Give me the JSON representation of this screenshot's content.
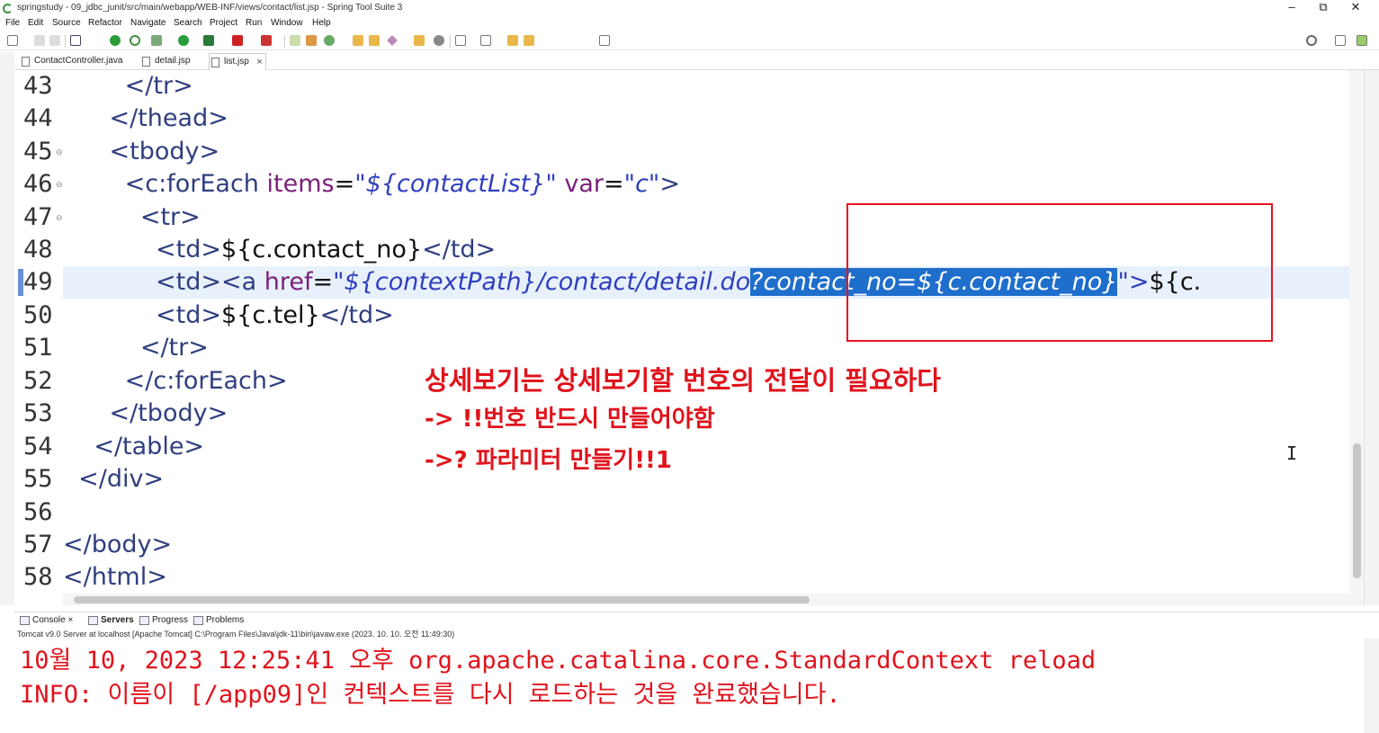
{
  "window": {
    "title": "springstudy - 09_jdbc_junit/src/main/webapp/WEB-INF/views/contact/list.jsp - Spring Tool Suite 3",
    "minimize": "–",
    "maximize": "⧉",
    "close": "✕"
  },
  "menu": [
    "File",
    "Edit",
    "Source",
    "Refactor",
    "Navigate",
    "Search",
    "Project",
    "Run",
    "Window",
    "Help"
  ],
  "tabs": [
    {
      "label": "ContactController.java"
    },
    {
      "label": "detail.jsp"
    },
    {
      "label": "list.jsp",
      "close": "×"
    }
  ],
  "code": {
    "lines": [
      {
        "no": "43",
        "text": "        </tr>"
      },
      {
        "no": "44",
        "text": "      </thead>"
      },
      {
        "no": "45",
        "text": "      <tbody>"
      },
      {
        "no": "46",
        "pre": "        <c:forEach ",
        "attr1": "items",
        "eq1": "=",
        "val1": "\"${contactList}\"",
        "sp": " ",
        "attr2": "var",
        "eq2": "=",
        "val2": "\"c\"",
        "end": ">"
      },
      {
        "no": "47",
        "text": "          <tr>"
      },
      {
        "no": "48",
        "pre": "            <td>",
        "body": "${c.contact_no}",
        "post": "</td>"
      },
      {
        "no": "49",
        "pre": "            <td><a ",
        "attr": "href",
        "eq": "=",
        "val_a": "\"${contextPath}/contact/detail.do",
        "val_sel": "?contact_no=${c.contact_no}",
        "val_b": "\">",
        "tail": "${c."
      },
      {
        "no": "50",
        "pre": "            <td>",
        "body": "${c.tel}",
        "post": "</td>"
      },
      {
        "no": "51",
        "text": "          </tr>"
      },
      {
        "no": "52",
        "text": "        </c:forEach>"
      },
      {
        "no": "53",
        "text": "      </tbody>"
      },
      {
        "no": "54",
        "text": "    </table>"
      },
      {
        "no": "55",
        "text": "  </div>"
      },
      {
        "no": "56",
        "text": ""
      },
      {
        "no": "57",
        "text": "</body>"
      },
      {
        "no": "58",
        "text": "</html>"
      }
    ]
  },
  "notes": [
    "상세보기는 상세보기할 번호의 전달이 필요하다",
    "-> !!번호 반드시 만들어야함",
    "->? 파라미터 만들기!!1"
  ],
  "console": {
    "tabs": [
      "Console",
      "Servers",
      "Progress",
      "Problems"
    ],
    "description": "Tomcat v9.0 Server at localhost [Apache Tomcat] C:\\Program Files\\Java\\jdk-11\\bin\\javaw.exe  (2023. 10. 10. 오전 11:49:30)",
    "lines": [
      "10월 10, 2023 12:25:41 오후 org.apache.catalina.core.StandardContext reload",
      "INFO: 이름이 [/app09]인 컨텍스트를 다시 로드하는 것을 완료했습니다."
    ]
  },
  "colors": {
    "annotation": "#e0131c",
    "selection": "#1e6ecc"
  }
}
